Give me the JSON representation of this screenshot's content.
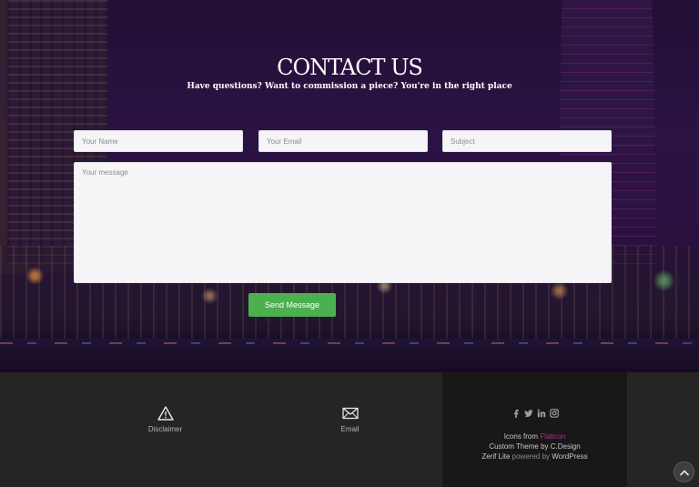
{
  "contact": {
    "title": "CONTACT US",
    "subtitle": "Have questions? Want to commission a piece? You're in the right place"
  },
  "form": {
    "name_placeholder": "Your Name",
    "email_placeholder": "Your Email",
    "subject_placeholder": "Subject",
    "message_placeholder": "Your message",
    "send_label": "Send Message",
    "send_color": "#4caf50"
  },
  "footer": {
    "disclaimer": {
      "icon": "warning-icon",
      "label": "Disclaimer"
    },
    "email": {
      "icon": "envelope-icon",
      "label": "Email"
    },
    "social": {
      "facebook": "f",
      "twitter": "t",
      "linkedin": "in",
      "instagram": "ig"
    },
    "credits": {
      "icons_prefix": "Icons from ",
      "flaticon": "Flaticon",
      "custom_theme": "Custom Theme by C.Design",
      "zerif_lite": "Zerif Lite",
      "powered_by": " powered by ",
      "wordpress": "WordPress"
    }
  },
  "colors": {
    "accent": "#4caf50",
    "flaticon_link": "#a4338f",
    "footer_bg": "#252525",
    "credits_bg": "#181818"
  }
}
